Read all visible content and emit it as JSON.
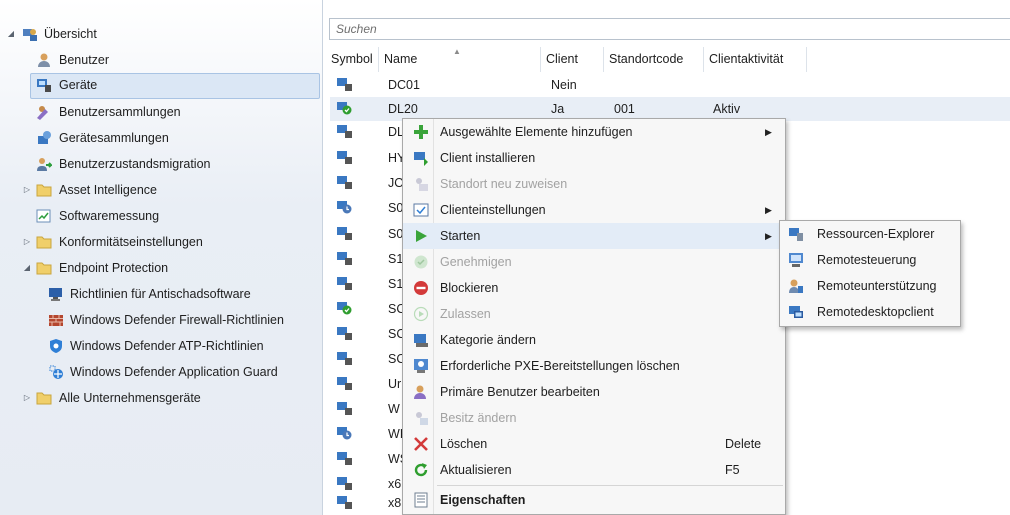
{
  "nav": {
    "root": {
      "label": "Übersicht"
    },
    "items": [
      {
        "label": "Benutzer"
      },
      {
        "label": "Geräte"
      },
      {
        "label": "Benutzersammlungen"
      },
      {
        "label": "Gerätesammlungen"
      },
      {
        "label": "Benutzerzustandsmigration"
      },
      {
        "label": "Asset Intelligence"
      },
      {
        "label": "Softwaremessung"
      },
      {
        "label": "Konformitätseinstellungen"
      },
      {
        "label": "Endpoint Protection"
      },
      {
        "label": "Richtlinien für Antischadsoftware"
      },
      {
        "label": "Windows Defender Firewall-Richtlinien"
      },
      {
        "label": "Windows Defender ATP-Richtlinien"
      },
      {
        "label": "Windows Defender Application Guard"
      },
      {
        "label": "Alle Unternehmensgeräte"
      }
    ]
  },
  "search": {
    "placeholder": "Suchen"
  },
  "columns": [
    "Symbol",
    "Name",
    "Client",
    "Standortcode",
    "Clientaktivität"
  ],
  "rows": [
    {
      "name": "DC01",
      "client": "Nein",
      "site": "",
      "activity": ""
    },
    {
      "name": "DL20",
      "client": "Ja",
      "site": "001",
      "activity": "Aktiv"
    },
    {
      "name": "DL",
      "client": "",
      "site": "",
      "activity": ""
    },
    {
      "name": "HY",
      "client": "",
      "site": "",
      "activity": ""
    },
    {
      "name": "JO",
      "client": "",
      "site": "",
      "activity": ""
    },
    {
      "name": "S0",
      "client": "",
      "site": "",
      "activity": ""
    },
    {
      "name": "S0",
      "client": "",
      "site": "",
      "activity": ""
    },
    {
      "name": "S1",
      "client": "",
      "site": "",
      "activity": ""
    },
    {
      "name": "S1",
      "client": "",
      "site": "",
      "activity": ""
    },
    {
      "name": "SC",
      "client": "",
      "site": "",
      "activity": ""
    },
    {
      "name": "SC",
      "client": "",
      "site": "",
      "activity": ""
    },
    {
      "name": "SC",
      "client": "",
      "site": "",
      "activity": ""
    },
    {
      "name": "Ur",
      "client": "",
      "site": "",
      "activity": ""
    },
    {
      "name": "W",
      "client": "",
      "site": "",
      "activity": ""
    },
    {
      "name": "WI",
      "client": "",
      "site": "",
      "activity": ""
    },
    {
      "name": "WS",
      "client": "",
      "site": "",
      "activity": ""
    },
    {
      "name": "x6",
      "client": "",
      "site": "",
      "activity": ""
    },
    {
      "name": "x8",
      "client": "",
      "site": "",
      "activity": ""
    }
  ],
  "context_menu": {
    "items": [
      {
        "label": "Ausgewählte Elemente hinzufügen",
        "icon": "add-green-plus-icon"
      },
      {
        "label": "Client installieren",
        "icon": "install-client-icon"
      },
      {
        "label": "Standort neu zuweisen",
        "icon": "reassign-site-icon"
      },
      {
        "label": "Clienteinstellungen",
        "icon": "client-settings-icon"
      },
      {
        "label": "Starten",
        "icon": "start-play-icon"
      },
      {
        "label": "Genehmigen",
        "icon": "approve-icon"
      },
      {
        "label": "Blockieren",
        "icon": "block-icon"
      },
      {
        "label": "Zulassen",
        "icon": "allow-icon"
      },
      {
        "label": "Kategorie ändern",
        "icon": "change-category-icon"
      },
      {
        "label": "Erforderliche PXE-Bereitstellungen löschen",
        "icon": "clear-pxe-icon"
      },
      {
        "label": "Primäre Benutzer bearbeiten",
        "icon": "edit-users-icon"
      },
      {
        "label": "Besitz ändern",
        "icon": "change-ownership-icon"
      },
      {
        "label": "Löschen",
        "icon": "delete-x-icon",
        "shortcut": "Delete"
      },
      {
        "label": "Aktualisieren",
        "icon": "refresh-icon",
        "shortcut": "F5"
      },
      {
        "label": "Eigenschaften",
        "icon": "properties-icon"
      }
    ]
  },
  "submenu": {
    "items": [
      {
        "label": "Ressourcen-Explorer",
        "icon": "resource-explorer-icon"
      },
      {
        "label": "Remotesteuerung",
        "icon": "remote-control-icon"
      },
      {
        "label": "Remoteunterstützung",
        "icon": "remote-assistance-icon"
      },
      {
        "label": "Remotedesktopclient",
        "icon": "remote-desktop-icon"
      }
    ]
  },
  "colors": {
    "selection": "#dbe7f5",
    "nav_bg": "#e9eef5",
    "disabled_text": "#a2a2a2",
    "accent_green": "#2f9e2f"
  }
}
